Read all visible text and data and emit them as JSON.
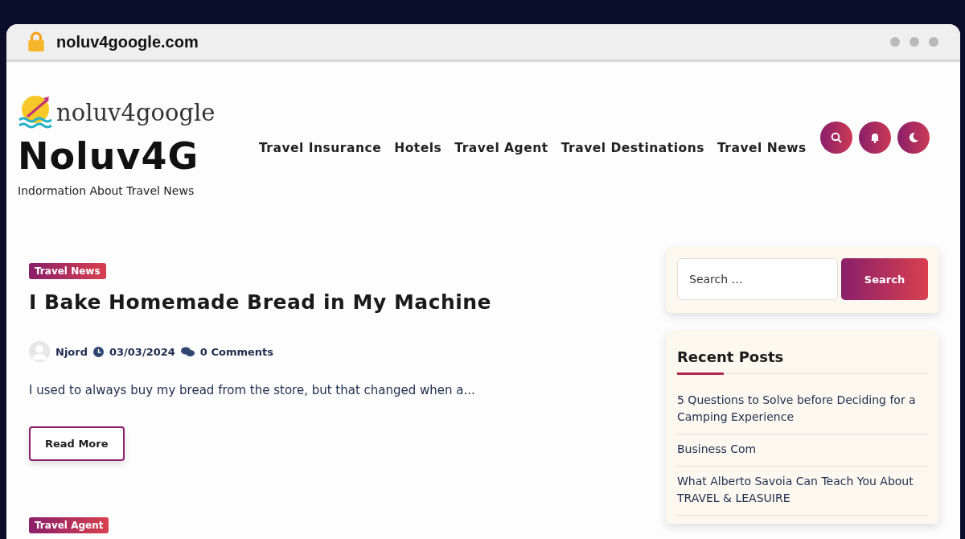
{
  "browser": {
    "url": "noluv4google.com"
  },
  "site": {
    "logo_text": "noluv4google",
    "title": "Noluv4G",
    "tagline": "Indormation About Travel News"
  },
  "nav": [
    "Travel Insurance",
    "Hotels",
    "Travel Agent",
    "Travel Destinations",
    "Travel News"
  ],
  "posts": [
    {
      "category": "Travel News",
      "title": "I Bake Homemade Bread in My Machine",
      "author": "Njord",
      "date": "03/03/2024",
      "comments": "0 Comments",
      "excerpt": "I used to always buy my bread from the store, but that changed when a...",
      "button": "Read More"
    },
    {
      "category": "Travel Agent"
    }
  ],
  "search": {
    "placeholder": "Search …",
    "button": "Search"
  },
  "recent_posts": {
    "title": "Recent Posts",
    "items": [
      "5 Questions to Solve before Deciding for a Camping Experience",
      "Business Com",
      "What Alberto Savoia Can Teach You About TRAVEL & LEASUIRE"
    ]
  }
}
